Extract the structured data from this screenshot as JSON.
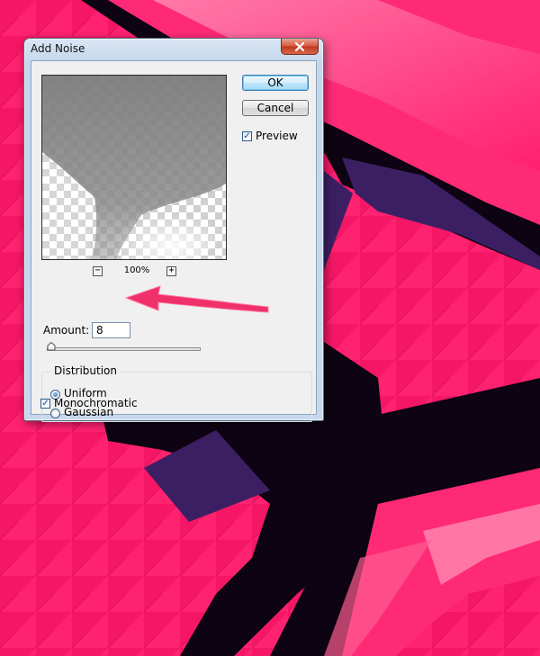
{
  "dialog": {
    "title": "Add Noise",
    "ok_label": "OK",
    "cancel_label": "Cancel",
    "preview_label": "Preview",
    "preview_checked": true,
    "zoom_minus": "−",
    "zoom_plus": "+",
    "zoom_level": "100%",
    "amount_label": "Amount:",
    "amount_value": "8",
    "amount_slider_fraction": 0.02,
    "distribution": {
      "legend": "Distribution",
      "options": [
        "Uniform",
        "Gaussian"
      ],
      "selected": "Uniform"
    },
    "monochromatic_label": "Monochromatic",
    "monochromatic_checked": true
  },
  "colors": {
    "background_pink": "#ff1f6e",
    "background_dark": "#0d0312",
    "background_purple": "#3c1f63",
    "arrow": "#f0306a"
  },
  "icons": {
    "close": "close-x-icon",
    "checkmark": "check-icon"
  }
}
